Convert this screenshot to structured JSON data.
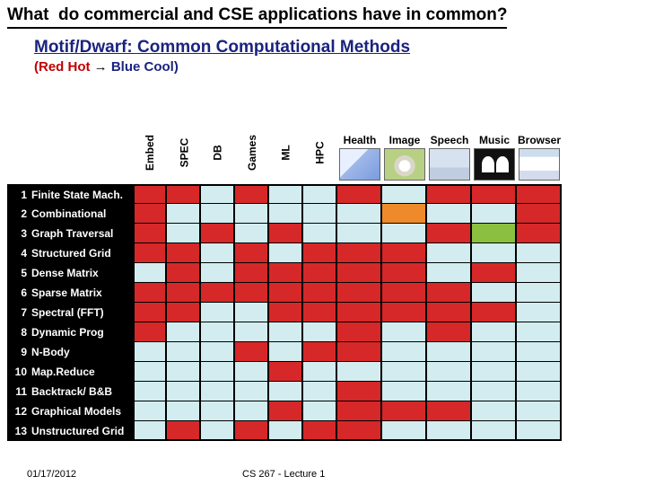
{
  "title": "What  do commercial and CSE applications have in common?",
  "subtitle": "Motif/Dwarf: Common Computational Methods",
  "caption_parts": {
    "red": "(Red Hot",
    "arrow": " → ",
    "blue": "Blue Cool)"
  },
  "columns_narrow": [
    "Embed",
    "SPEC",
    "DB",
    "Games",
    "ML",
    "HPC"
  ],
  "columns_wide": [
    "Health",
    "Image",
    "Speech",
    "Music",
    "Browser"
  ],
  "rows": [
    {
      "n": "1",
      "label": "Finite State Mach."
    },
    {
      "n": "2",
      "label": "Combinational"
    },
    {
      "n": "3",
      "label": "Graph Traversal"
    },
    {
      "n": "4",
      "label": "Structured Grid"
    },
    {
      "n": "5",
      "label": "Dense Matrix"
    },
    {
      "n": "6",
      "label": "Sparse Matrix"
    },
    {
      "n": "7",
      "label": "Spectral (FFT)"
    },
    {
      "n": "8",
      "label": "Dynamic Prog"
    },
    {
      "n": "9",
      "label": "N-Body"
    },
    {
      "n": "10",
      "label": "Map.Reduce"
    },
    {
      "n": "11",
      "label": "Backtrack/ B&B"
    },
    {
      "n": "12",
      "label": "Graphical Models"
    },
    {
      "n": "13",
      "label": "Unstructured Grid"
    }
  ],
  "footer": {
    "date": "01/17/2012",
    "course": "CS 267 - Lecture 1"
  },
  "chart_data": {
    "type": "heatmap",
    "title": "Motif/Dwarf: Common Computational Methods",
    "legend": "Red Hot → Blue Cool",
    "scale_note": "0 = cool (light blue) … 4 = hot (red); values estimated from cell colors",
    "x_columns": [
      "Embed",
      "SPEC",
      "DB",
      "Games",
      "ML",
      "HPC",
      "Health",
      "Image",
      "Speech",
      "Music",
      "Browser"
    ],
    "y_rows": [
      "Finite State Mach.",
      "Combinational",
      "Graph Traversal",
      "Structured Grid",
      "Dense Matrix",
      "Sparse Matrix",
      "Spectral (FFT)",
      "Dynamic Prog",
      "N-Body",
      "Map.Reduce",
      "Backtrack/ B&B",
      "Graphical Models",
      "Unstructured Grid"
    ],
    "matrix": [
      [
        4,
        4,
        0,
        4,
        0,
        0,
        4,
        0,
        4,
        4,
        4
      ],
      [
        4,
        0,
        0,
        0,
        0,
        0,
        0,
        3,
        0,
        0,
        4
      ],
      [
        4,
        0,
        4,
        0,
        4,
        0,
        0,
        0,
        4,
        2,
        4
      ],
      [
        4,
        4,
        0,
        4,
        0,
        4,
        4,
        4,
        0,
        0,
        0
      ],
      [
        0,
        4,
        0,
        4,
        4,
        4,
        4,
        4,
        0,
        4,
        0
      ],
      [
        4,
        4,
        4,
        4,
        4,
        4,
        4,
        4,
        4,
        0,
        0
      ],
      [
        4,
        4,
        0,
        0,
        4,
        4,
        4,
        4,
        4,
        4,
        0
      ],
      [
        4,
        0,
        0,
        0,
        0,
        0,
        4,
        0,
        4,
        0,
        0
      ],
      [
        0,
        0,
        0,
        4,
        0,
        4,
        4,
        0,
        0,
        0,
        0
      ],
      [
        0,
        0,
        0,
        0,
        4,
        0,
        0,
        0,
        0,
        0,
        0
      ],
      [
        0,
        0,
        0,
        0,
        0,
        0,
        4,
        0,
        0,
        0,
        0
      ],
      [
        0,
        0,
        0,
        0,
        4,
        0,
        4,
        4,
        4,
        0,
        0
      ],
      [
        0,
        4,
        0,
        4,
        0,
        4,
        4,
        0,
        0,
        0,
        0
      ]
    ]
  }
}
